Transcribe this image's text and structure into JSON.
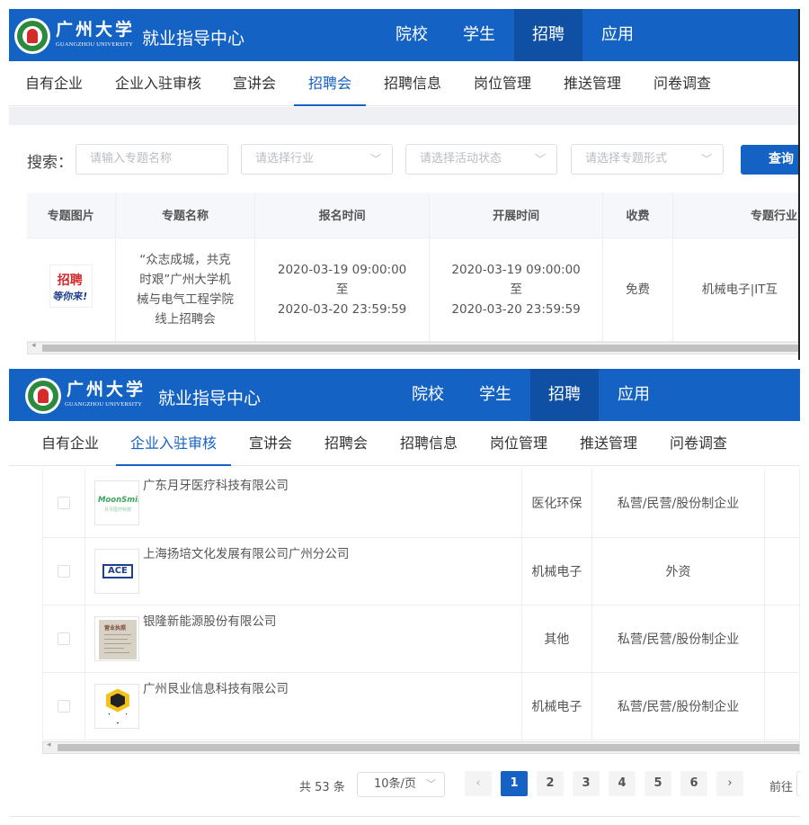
{
  "header": {
    "university_cn": "广州大学",
    "university_en": "GUANGZHOU UNIVERSITY",
    "site_title": "就业指导中心",
    "nav": [
      "院校",
      "学生",
      "招聘",
      "应用"
    ],
    "active_nav": "招聘"
  },
  "subnav": {
    "items": [
      "自有企业",
      "企业入驻审核",
      "宣讲会",
      "招聘会",
      "招聘信息",
      "岗位管理",
      "推送管理",
      "问卷调查"
    ]
  },
  "top_panel": {
    "active_subnav": "招聘会",
    "search": {
      "label": "搜索：",
      "name_placeholder": "请输入专题名称",
      "industry_placeholder": "请选择行业",
      "status_placeholder": "请选择活动状态",
      "form_placeholder": "请选择专题形式",
      "query_button": "查询"
    },
    "table": {
      "columns": [
        "专题图片",
        "专题名称",
        "报名时间",
        "开展时间",
        "收费",
        "专题行业"
      ],
      "rows": [
        {
          "poster_text_1": "招聘",
          "poster_text_2": "等你来!",
          "name": "“众志成城，共克时艰”广州大学机械与电气工程学院线上招聘会",
          "signup_start": "2020-03-19 09:00:00",
          "signup_to": "至",
          "signup_end": "2020-03-20 23:59:59",
          "run_start": "2020-03-19 09:00:00",
          "run_to": "至",
          "run_end": "2020-03-20 23:59:59",
          "fee": "免费",
          "industry": "机械电子|IT互"
        }
      ]
    }
  },
  "bottom_panel": {
    "active_subnav": "企业入驻审核",
    "companies": [
      {
        "name": "广东月牙医疗科技有限公司",
        "industry": "医化环保",
        "ownership": "私营/民营/股份制企业",
        "logo": "moonsmile-logo",
        "logo_text": "MoonSmile",
        "logo_subtext": "月牙医疗科技"
      },
      {
        "name": "上海扬培文化发展有限公司广州分公司",
        "industry": "机械电子",
        "ownership": "外资",
        "logo": "ace-logo",
        "logo_text": "ACE"
      },
      {
        "name": "银隆新能源股份有限公司",
        "industry": "其他",
        "ownership": "私营/民营/股份制企业",
        "logo": "business-license-image",
        "logo_text": "营业执照"
      },
      {
        "name": "广州艮业信息科技有限公司",
        "industry": "机械电子",
        "ownership": "私营/民营/股份制企业",
        "logo": "hexagon-logo"
      }
    ],
    "pagination": {
      "total": "共 53 条",
      "page_size": "10条/页",
      "prev": "‹",
      "next": "›",
      "pages": [
        "1",
        "2",
        "3",
        "4",
        "5",
        "6"
      ],
      "current": "1",
      "jump_label": "前往"
    }
  },
  "colors": {
    "header_bg": "#1462c4",
    "header_active_bg": "#0f50a4",
    "accent": "#1462c4"
  }
}
